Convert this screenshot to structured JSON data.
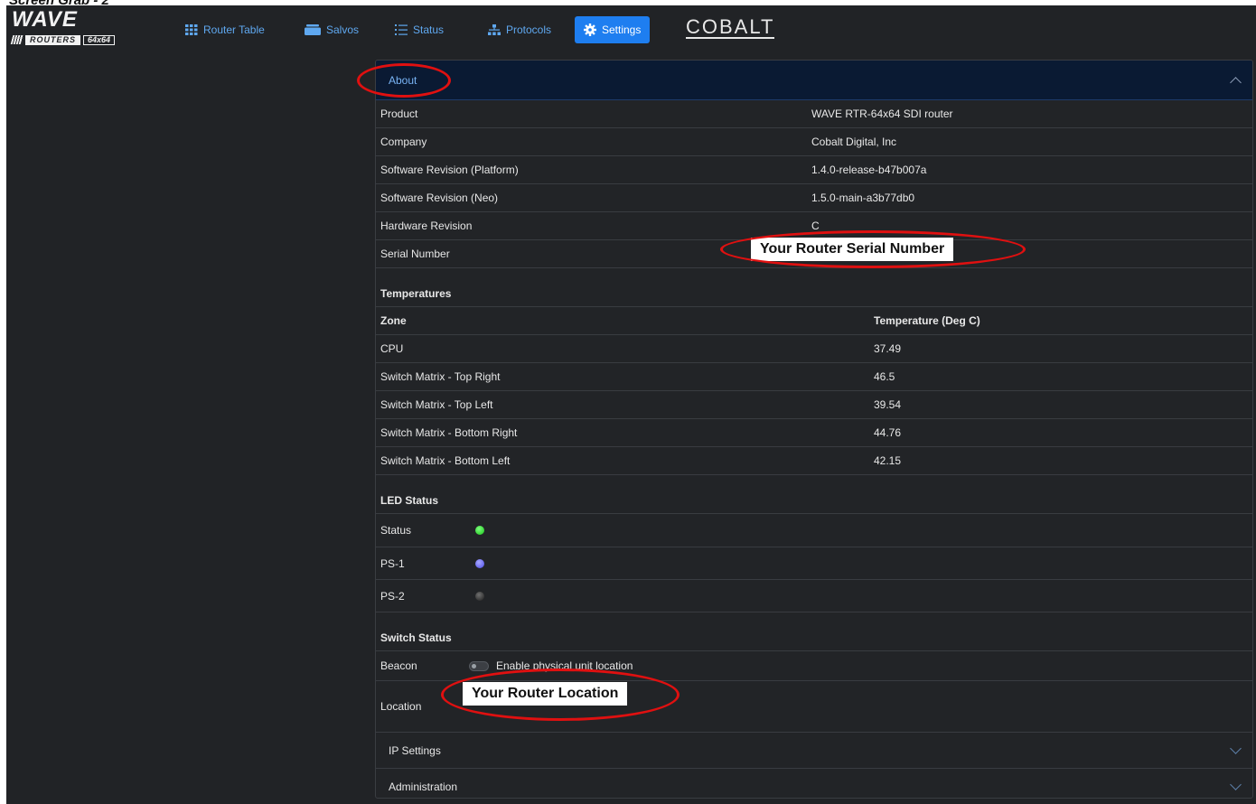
{
  "caption": "Screen Grab - 2",
  "logo": {
    "brand": "WAVE",
    "sub": "ROUTERS",
    "size": "64x64"
  },
  "nav": [
    {
      "label": "Router Table",
      "icon": "grid-icon"
    },
    {
      "label": "Salvos",
      "icon": "stack-icon"
    },
    {
      "label": "Status",
      "icon": "list-icon"
    },
    {
      "label": "Protocols",
      "icon": "network-icon"
    },
    {
      "label": "Settings",
      "icon": "gear-icon"
    }
  ],
  "cobalt": "COBALT",
  "about": {
    "title": "About",
    "rows": [
      {
        "label": "Product",
        "value": "WAVE RTR-64x64 SDI router"
      },
      {
        "label": "Company",
        "value": "Cobalt Digital, Inc"
      },
      {
        "label": "Software Revision (Platform)",
        "value": "1.4.0-release-b47b007a"
      },
      {
        "label": "Software Revision (Neo)",
        "value": "1.5.0-main-a3b77db0"
      },
      {
        "label": "Hardware Revision",
        "value": "C"
      },
      {
        "label": "Serial Number",
        "value": ""
      }
    ]
  },
  "temperatures": {
    "title": "Temperatures",
    "col_zone": "Zone",
    "col_temp": "Temperature (Deg C)",
    "rows": [
      {
        "zone": "CPU",
        "temp": "37.49"
      },
      {
        "zone": "Switch Matrix - Top Right",
        "temp": "46.5"
      },
      {
        "zone": "Switch Matrix - Top Left",
        "temp": "39.54"
      },
      {
        "zone": "Switch Matrix - Bottom Right",
        "temp": "44.76"
      },
      {
        "zone": "Switch Matrix - Bottom Left",
        "temp": "42.15"
      }
    ]
  },
  "led": {
    "title": "LED Status",
    "rows": [
      {
        "label": "Status",
        "color": "#2ee52e"
      },
      {
        "label": "PS-1",
        "color": "#5b5bf0"
      },
      {
        "label": "PS-2",
        "color": "#222222"
      }
    ]
  },
  "switch": {
    "title": "Switch Status",
    "beacon_label": "Beacon",
    "beacon_toggle_label": "Enable physical unit location",
    "beacon_on": false,
    "location_label": "Location"
  },
  "accordions": {
    "ip": "IP Settings",
    "admin": "Administration"
  },
  "annotations": {
    "serial": "Your Router Serial Number",
    "location": "Your Router Location",
    "ring_color": "#e01010"
  }
}
